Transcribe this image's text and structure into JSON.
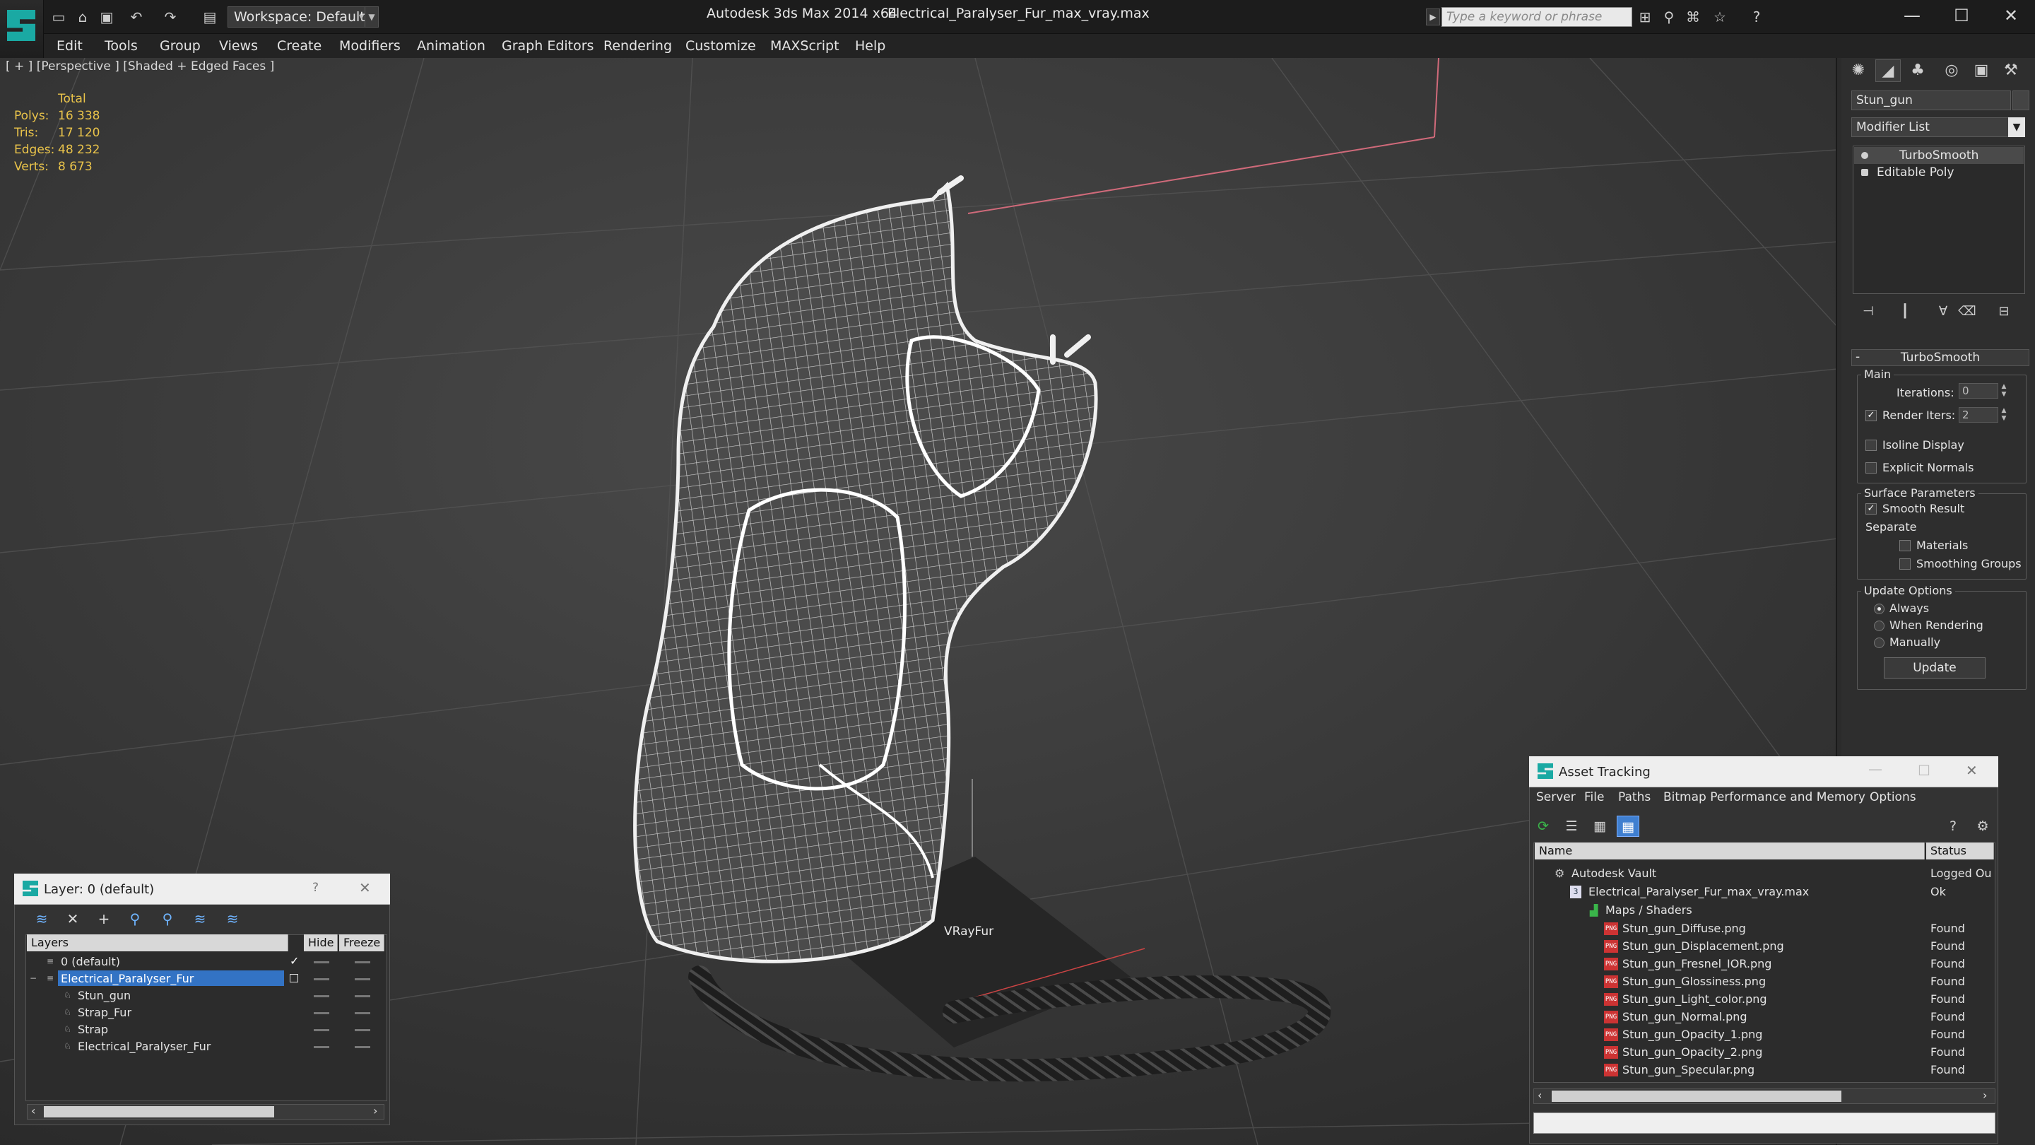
{
  "titlebar": {
    "app_title": "Autodesk 3ds Max  2014 x64",
    "file_name": "Electrical_Paralyser_Fur_max_vray.max",
    "workspace": "Workspace: Default",
    "search_placeholder": "Type a keyword or phrase",
    "minimize": "—",
    "maximize": "☐",
    "close": "✕"
  },
  "menu": [
    "Edit",
    "Tools",
    "Group",
    "Views",
    "Create",
    "Modifiers",
    "Animation",
    "Graph Editors",
    "Rendering",
    "Customize",
    "MAXScript",
    "Help"
  ],
  "viewport": {
    "label": "[ + ] [Perspective ] [Shaded + Edged Faces ]",
    "stats_header": "Total",
    "stats": [
      {
        "label": "Polys:",
        "value": "16 338"
      },
      {
        "label": "Tris:",
        "value": "17 120"
      },
      {
        "label": "Edges:",
        "value": "48 232"
      },
      {
        "label": "Verts:",
        "value": "8 673"
      }
    ],
    "helper_label": "VRayFur"
  },
  "command_panel": {
    "object_name": "Stun_gun",
    "modifier_list": "Modifier List",
    "stack": [
      "TurboSmooth",
      "Editable Poly"
    ],
    "rollout_title": "TurboSmooth",
    "main_group": "Main",
    "iterations_label": "Iterations:",
    "iterations_value": "0",
    "render_iters_label": "Render Iters:",
    "render_iters_value": "2",
    "isoline_label": "Isoline Display",
    "explicit_normals_label": "Explicit Normals",
    "surface_group": "Surface Parameters",
    "smooth_result_label": "Smooth Result",
    "separate_label": "Separate",
    "materials_label": "Materials",
    "smoothing_groups_label": "Smoothing Groups",
    "update_group": "Update Options",
    "always_label": "Always",
    "when_rendering_label": "When Rendering",
    "manually_label": "Manually",
    "update_button": "Update"
  },
  "layer_dialog": {
    "title": "Layer: 0 (default)",
    "help": "?",
    "close": "✕",
    "columns": [
      "Layers",
      "Hide",
      "Freeze"
    ],
    "rows": [
      "0 (default)",
      "Electrical_Paralyser_Fur",
      "Stun_gun",
      "Strap_Fur",
      "Strap",
      "Electrical_Paralyser_Fur"
    ],
    "check": "✓"
  },
  "asset_dialog": {
    "title": "Asset Tracking",
    "close": "✕",
    "menu": [
      "Server",
      "File",
      "Paths",
      "Bitmap Performance and Memory",
      "Options"
    ],
    "columns": [
      "Name",
      "Status"
    ],
    "rows": [
      {
        "name": "Autodesk Vault",
        "status": "Logged Ou"
      },
      {
        "name": "Electrical_Paralyser_Fur_max_vray.max",
        "status": "Ok"
      },
      {
        "name": "Maps / Shaders",
        "status": ""
      },
      {
        "name": "Stun_gun_Diffuse.png",
        "status": "Found"
      },
      {
        "name": "Stun_gun_Displacement.png",
        "status": "Found"
      },
      {
        "name": "Stun_gun_Fresnel_IOR.png",
        "status": "Found"
      },
      {
        "name": "Stun_gun_Glossiness.png",
        "status": "Found"
      },
      {
        "name": "Stun_gun_Light_color.png",
        "status": "Found"
      },
      {
        "name": "Stun_gun_Normal.png",
        "status": "Found"
      },
      {
        "name": "Stun_gun_Opacity_1.png",
        "status": "Found"
      },
      {
        "name": "Stun_gun_Opacity_2.png",
        "status": "Found"
      },
      {
        "name": "Stun_gun_Specular.png",
        "status": "Found"
      }
    ],
    "png_badge": "PNG"
  },
  "colors": {
    "accent": "#1aa9a3",
    "selection": "#3373c4",
    "stats": "#e9c34a"
  }
}
